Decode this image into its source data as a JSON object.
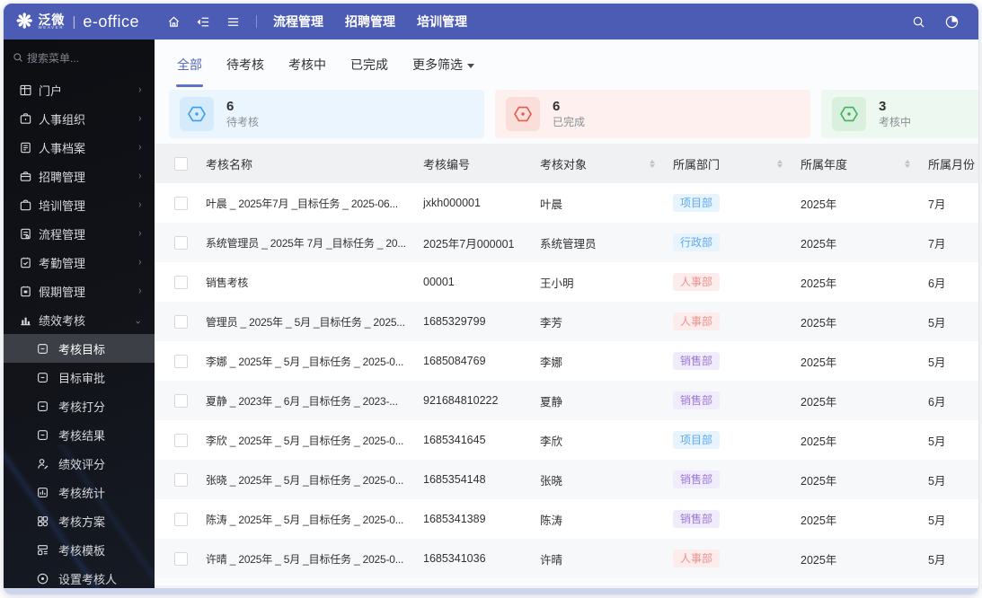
{
  "navbar": {
    "brand": "泛微",
    "brand_sub": "WEAVER",
    "product": "e-office",
    "menu": [
      "流程管理",
      "招聘管理",
      "培训管理"
    ]
  },
  "sidebar": {
    "search_placeholder": "搜索菜单...",
    "items": [
      {
        "label": "门户",
        "icon": "portal-icon"
      },
      {
        "label": "人事组织",
        "icon": "hr-org-icon"
      },
      {
        "label": "人事档案",
        "icon": "hr-archive-icon"
      },
      {
        "label": "招聘管理",
        "icon": "recruit-icon"
      },
      {
        "label": "培训管理",
        "icon": "training-icon"
      },
      {
        "label": "流程管理",
        "icon": "workflow-icon"
      },
      {
        "label": "考勤管理",
        "icon": "attendance-icon"
      },
      {
        "label": "假期管理",
        "icon": "leave-icon"
      },
      {
        "label": "绩效考核",
        "icon": "performance-icon",
        "expanded": true
      }
    ],
    "submenu": [
      {
        "label": "考核目标",
        "icon": "goal-icon",
        "active": true
      },
      {
        "label": "目标审批",
        "icon": "approve-icon"
      },
      {
        "label": "考核打分",
        "icon": "score-icon"
      },
      {
        "label": "考核结果",
        "icon": "result-icon"
      },
      {
        "label": "绩效评分",
        "icon": "rating-icon"
      },
      {
        "label": "考核统计",
        "icon": "stats-icon"
      },
      {
        "label": "考核方案",
        "icon": "plan-icon"
      },
      {
        "label": "考核模板",
        "icon": "template-icon"
      },
      {
        "label": "设置考核人",
        "icon": "assessor-icon"
      }
    ]
  },
  "tabs": {
    "items": [
      "全部",
      "待考核",
      "考核中",
      "已完成"
    ],
    "active_index": 0,
    "more_label": "更多筛选"
  },
  "stats": [
    {
      "value": "6",
      "label": "待考核",
      "theme": "blue",
      "color": "#3b9ff0"
    },
    {
      "value": "6",
      "label": "已完成",
      "theme": "red",
      "color": "#e25c54"
    },
    {
      "value": "3",
      "label": "考核中",
      "theme": "green",
      "color": "#43b05c"
    }
  ],
  "table": {
    "columns": [
      {
        "label": "考核名称",
        "sortable": false
      },
      {
        "label": "考核编号",
        "sortable": false
      },
      {
        "label": "考核对象",
        "sortable": true
      },
      {
        "label": "所属部门",
        "sortable": true
      },
      {
        "label": "所属年度",
        "sortable": true
      },
      {
        "label": "所属月份",
        "sortable": false
      }
    ],
    "rows": [
      {
        "name": "叶晨 _ 2025年7月 _目标任务 _ 2025-06...",
        "code": "jxkh000001",
        "subject": "叶晨",
        "dept": "项目部",
        "dept_color": "blue",
        "year": "2025年",
        "month": "7月"
      },
      {
        "name": "系统管理员 _ 2025年 7月 _目标任务 _ 20...",
        "code": "2025年7月000001",
        "subject": "系统管理员",
        "dept": "行政部",
        "dept_color": "blue",
        "year": "2025年",
        "month": "7月"
      },
      {
        "name": "销售考核",
        "code": "00001",
        "subject": "王小明",
        "dept": "人事部",
        "dept_color": "red",
        "year": "2025年",
        "month": "6月"
      },
      {
        "name": "管理员 _ 2025年 _ 5月 _目标任务 _ 2025...",
        "code": "1685329799",
        "subject": "李芳",
        "dept": "人事部",
        "dept_color": "red",
        "year": "2025年",
        "month": "5月"
      },
      {
        "name": "李娜 _ 2025年 _ 5月 _目标任务 _ 2025-0...",
        "code": "1685084769",
        "subject": "李娜",
        "dept": "销售部",
        "dept_color": "purple",
        "year": "2025年",
        "month": "5月"
      },
      {
        "name": "夏静 _ 2023年 _ 6月 _目标任务 _ 2023-...",
        "code": "921684810222",
        "subject": "夏静",
        "dept": "销售部",
        "dept_color": "purple",
        "year": "2025年",
        "month": "6月"
      },
      {
        "name": "李欣 _ 2025年 _ 5月 _目标任务 _ 2025-0...",
        "code": "1685341645",
        "subject": "李欣",
        "dept": "项目部",
        "dept_color": "blue",
        "year": "2025年",
        "month": "5月"
      },
      {
        "name": "张晓 _ 2025年 _ 5月 _目标任务 _ 2025-0...",
        "code": "1685354148",
        "subject": "张晓",
        "dept": "销售部",
        "dept_color": "purple",
        "year": "2025年",
        "month": "5月"
      },
      {
        "name": "陈涛 _ 2025年 _ 5月 _目标任务 _ 2025-0...",
        "code": "1685341389",
        "subject": "陈涛",
        "dept": "销售部",
        "dept_color": "purple",
        "year": "2025年",
        "month": "5月"
      },
      {
        "name": "许晴 _ 2025年 _ 5月 _目标任务 _ 2025-0...",
        "code": "1685341036",
        "subject": "许晴",
        "dept": "人事部",
        "dept_color": "red",
        "year": "2025年",
        "month": "5月"
      }
    ]
  }
}
